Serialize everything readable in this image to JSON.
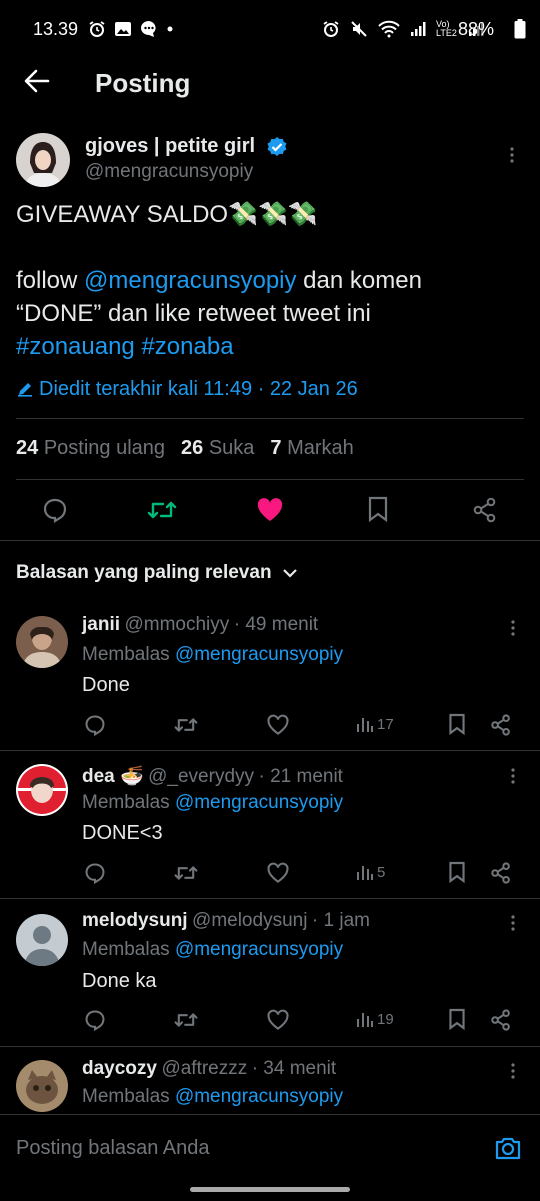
{
  "status_bar": {
    "time": "13.39",
    "network": "Vo) LTE2",
    "battery": "88%"
  },
  "header": {
    "title": "Posting"
  },
  "post": {
    "author_name": "gjoves | petite girl",
    "author_handle": "@mengracunsyopiy",
    "line1": "GIVEAWAY SALDO💸💸💸",
    "line2_pre": "follow ",
    "line2_mention": "@mengracunsyopiy",
    "line2_post": " dan komen",
    "line3": "“DONE” dan like retweet tweet ini",
    "hashtag1": "#zonauang",
    "hashtag2": "#zonaba",
    "edited": "Diedit terakhir kali 11:49 · 22 Jan 26",
    "reposts_count": "24",
    "reposts_label": "Posting ulang",
    "likes_count": "26",
    "likes_label": "Suka",
    "bookmarks_count": "7",
    "bookmarks_label": "Markah"
  },
  "replies_header": "Balasan yang paling relevan",
  "replies": [
    {
      "name": "janii",
      "handle": "@mmochiyy",
      "time": "· 49 menit",
      "replying_label": "Membalas",
      "replying_to": "@mengracunsyopiy",
      "text": "Done",
      "views": "17"
    },
    {
      "name": "dea 🍜",
      "handle": "@_everydyy",
      "time": "· 21 menit",
      "replying_label": "Membalas",
      "replying_to": "@mengracunsyopiy",
      "text": "DONE<3",
      "views": "5"
    },
    {
      "name": "melodysunj",
      "handle": "@melodysunj",
      "time": "· 1 jam",
      "replying_label": "Membalas",
      "replying_to": "@mengracunsyopiy",
      "text": "Done ka",
      "views": "19"
    },
    {
      "name": "daycozy",
      "handle": "@aftrezzz",
      "time": "· 34 menit",
      "replying_label": "Membalas",
      "replying_to": "@mengracunsyopiy"
    }
  ],
  "composer": {
    "placeholder": "Posting balasan Anda"
  },
  "colors": {
    "background": "#000000",
    "link": "#1d9bf0",
    "repost": "#00ba7c",
    "like": "#f91880",
    "muted": "#71767b"
  }
}
